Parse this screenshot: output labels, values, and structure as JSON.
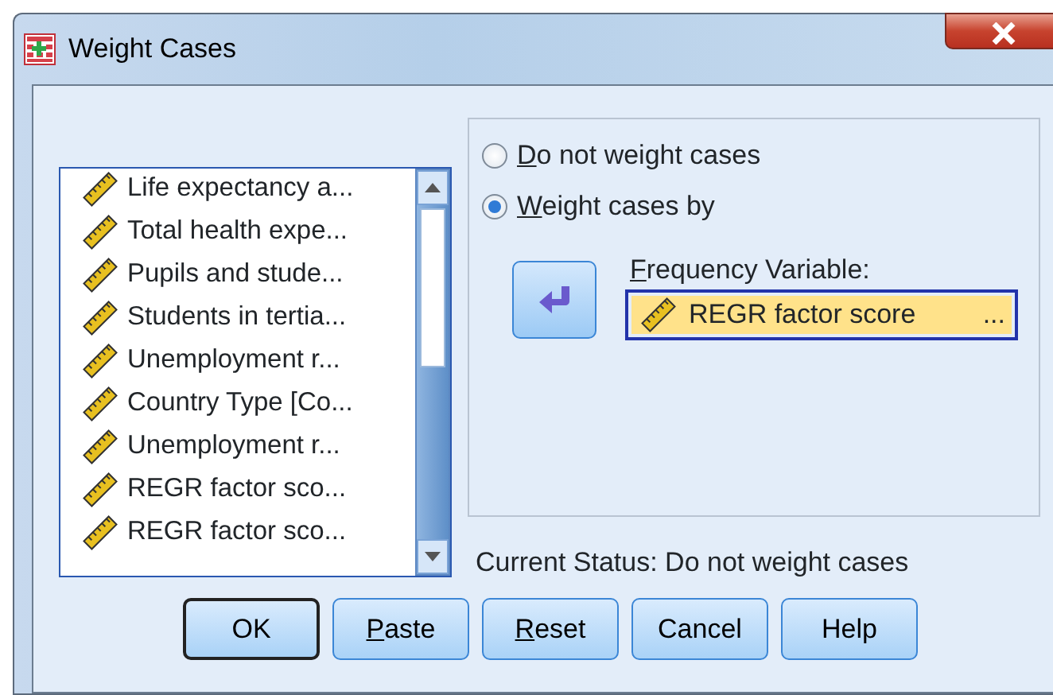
{
  "window": {
    "title": "Weight Cases"
  },
  "variables": [
    {
      "name": "Life expectancy a...",
      "selected": false
    },
    {
      "name": "Total health expe...",
      "selected": false
    },
    {
      "name": "Pupils and stude...",
      "selected": false
    },
    {
      "name": "Students in tertia...",
      "selected": false
    },
    {
      "name": "Unemployment r...",
      "selected": false
    },
    {
      "name": "Country Type [Co...",
      "selected": false
    },
    {
      "name": "Unemployment r...",
      "selected": false
    },
    {
      "name": "REGR factor sco...",
      "selected": false
    },
    {
      "name": "REGR factor sco...",
      "selected": false
    }
  ],
  "options": [
    {
      "label": "Do not weight cases",
      "first_letter_underlined": true,
      "selected": false
    },
    {
      "label": "Weight cases by",
      "first_letter_underlined": true,
      "selected": true
    }
  ],
  "frequency_variable": {
    "label": "Frequency Variable:",
    "first_letter_underlined": true,
    "value": "REGR factor score",
    "ellipsis": "..."
  },
  "current_status": "Current Status: Do not weight cases",
  "buttons": [
    {
      "label": "OK",
      "first_letter_underlined": false,
      "default": true
    },
    {
      "label": "Paste",
      "first_letter_underlined": true,
      "default": false
    },
    {
      "label": "Reset",
      "first_letter_underlined": true,
      "default": false
    },
    {
      "label": "Cancel",
      "first_letter_underlined": false,
      "default": false
    },
    {
      "label": "Help",
      "first_letter_underlined": false,
      "default": false
    }
  ]
}
